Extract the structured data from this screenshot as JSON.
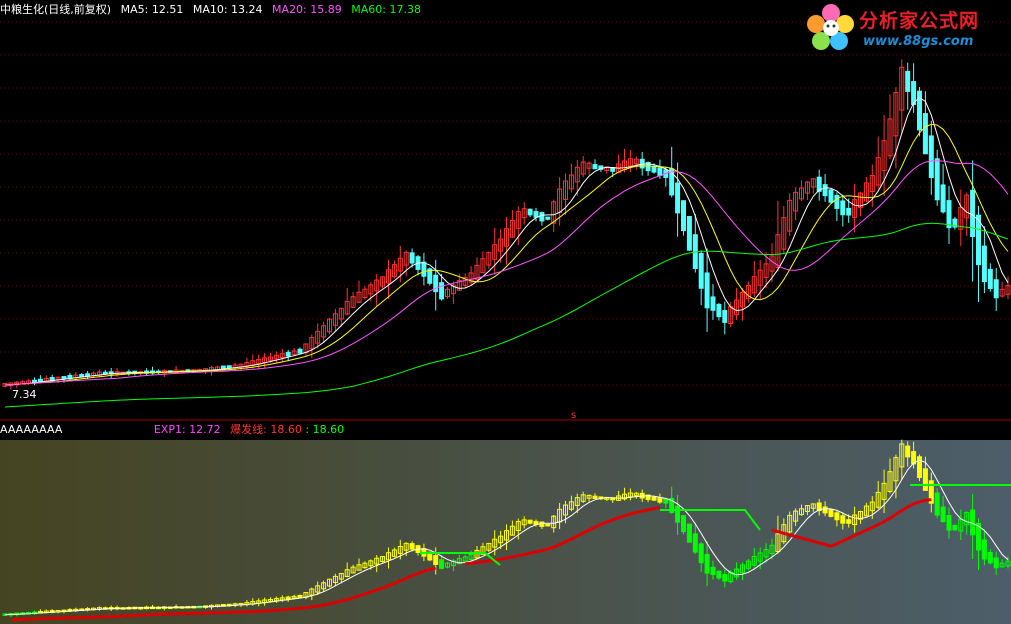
{
  "colors": {
    "background": "#000000",
    "grid": "#7a0000",
    "up": "#ff3232",
    "down": "#54ffff",
    "ma5": "#ffffff",
    "ma10": "#ffff00",
    "ma20": "#ff55ff",
    "ma60": "#00ff00",
    "exp1": "#ff44ff",
    "burst": "#ff3333",
    "sub_up": "#ffff00",
    "sub_down": "#00ff00",
    "sub_bg_left": "#454422",
    "sub_bg_right": "#4d5e6a",
    "sub_line_red": "#dd0000"
  },
  "header": {
    "title": "中粮生化(日线,前复权)",
    "ma5": {
      "label": "MA5:",
      "value": "12.51"
    },
    "ma10": {
      "label": "MA10:",
      "value": "13.24"
    },
    "ma20": {
      "label": "MA20:",
      "value": "15.89"
    },
    "ma60": {
      "label": "MA60:",
      "value": "17.38"
    }
  },
  "price_low_label": "7.34",
  "indicator": {
    "name": "AAAAAAAA",
    "exp1_label": "EXP1:",
    "exp1_value": "12.72",
    "burst_label": "爆发线:",
    "burst_value": "18.60",
    "green_value": ": 18.60"
  },
  "logo": {
    "title": "分析家公式网",
    "url": "www.88gs.com",
    "icon": "flower-icon"
  }
}
